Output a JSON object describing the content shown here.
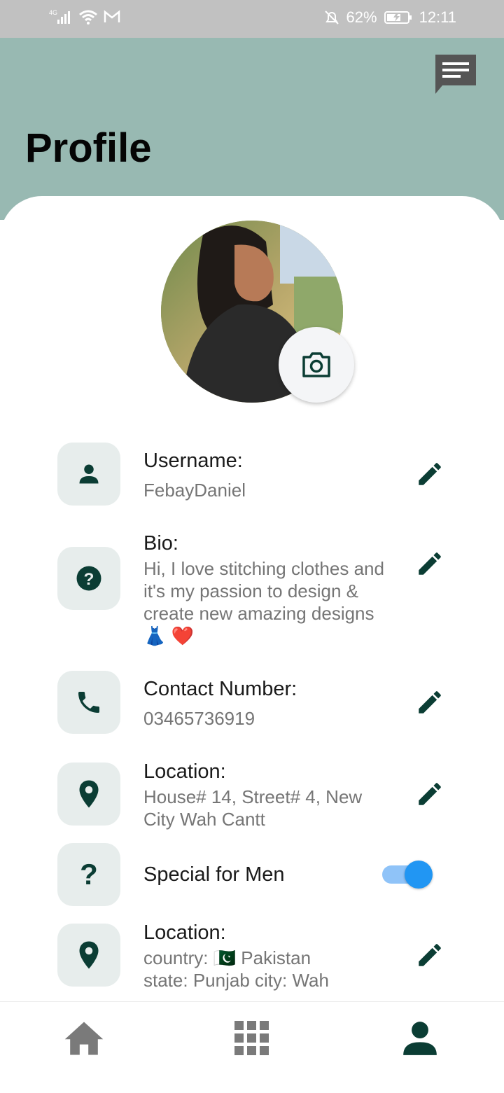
{
  "status_bar": {
    "network": "4G",
    "battery": "62%",
    "time": "12:11"
  },
  "header": {
    "title": "Profile",
    "background": "#98b9b2"
  },
  "profile": {
    "fields": [
      {
        "label": "Username:",
        "value": "FebayDaniel",
        "icon": "person-icon"
      },
      {
        "label": "Bio:",
        "value": "Hi, I love stitching clothes and it's my passion to design & create new amazing designs 👗 ❤️",
        "icon": "help-circle-icon"
      },
      {
        "label": "Contact Number:",
        "value": "03465736919",
        "icon": "phone-icon"
      },
      {
        "label": "Location:",
        "value": "House# 14, Street# 4, New City Wah Cantt",
        "icon": "location-pin-icon"
      },
      {
        "label": "Special for Men",
        "icon": "question-mark-icon",
        "toggle_on": true
      },
      {
        "label": "Location:",
        "value_line1": "country: 🇵🇰    Pakistan",
        "value_line2": "state: Punjab city: Wah",
        "icon": "location-pin-icon"
      }
    ]
  },
  "colors": {
    "icon_dark_green": "#0b3d34",
    "toggle_blue": "#2196f3",
    "tile_bg": "#e7edec"
  },
  "bottom_nav": {
    "items": [
      "home-icon",
      "grid-icon",
      "profile-icon"
    ],
    "active": "profile-icon"
  }
}
